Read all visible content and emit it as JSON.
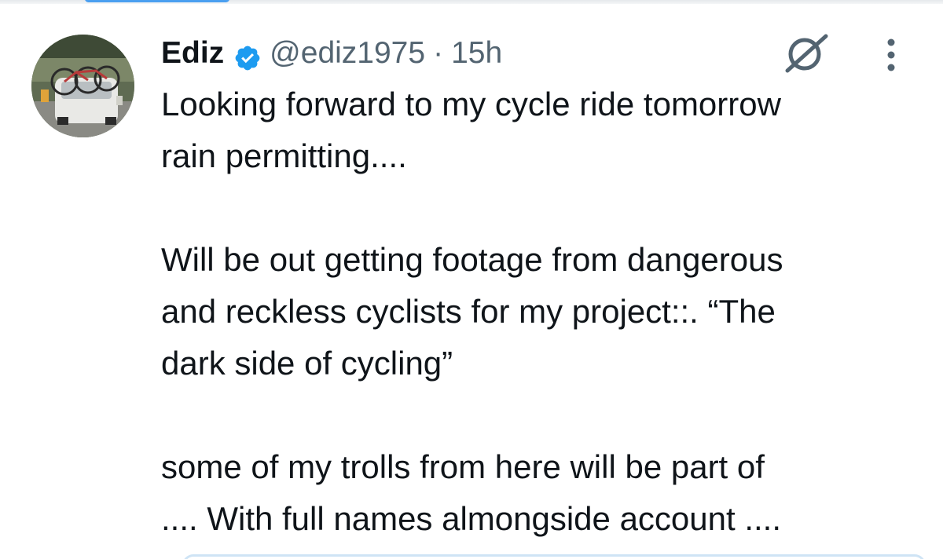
{
  "tweet": {
    "author": {
      "display_name": "Ediz",
      "verified": true,
      "handle": "@ediz1975"
    },
    "separator": "·",
    "time": "15h",
    "lines": [
      "Looking forward to my cycle ride tomorrow",
      "rain permitting....",
      "",
      "Will be out getting footage from dangerous",
      "and reckless cyclists for my project::. “The",
      "dark side of cycling”",
      "",
      "some of my trolls from here will be part of",
      ".... With full names almongside account ...."
    ]
  },
  "icons": {
    "verified": "verified-badge-icon",
    "grok": "grok-icon",
    "more": "more-vertical-icon"
  },
  "colors": {
    "text": "#0f1419",
    "secondary": "#536471",
    "verified": "#1d9bf0",
    "icon_gray": "#536471"
  }
}
